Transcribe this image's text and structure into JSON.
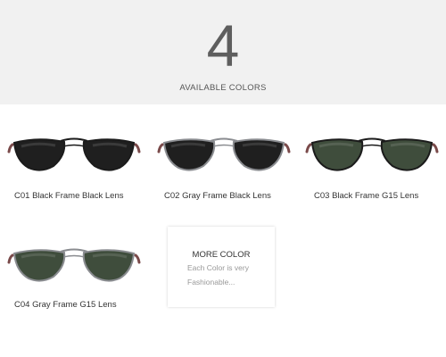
{
  "header": {
    "number": "4",
    "subtitle": "AVAILABLE COLORS"
  },
  "products": [
    {
      "code_label": "C01 Black Frame Black Lens",
      "frame_color": "#1b1b1b",
      "lens_color": "#1f1f1f",
      "temple_color": "#7a4a4a"
    },
    {
      "code_label": "C02 Gray Frame Black Lens",
      "frame_color": "#8a8c90",
      "lens_color": "#1f1f1f",
      "temple_color": "#7a4a4a"
    },
    {
      "code_label": "C03 Black Frame G15 Lens",
      "frame_color": "#1b1b1b",
      "lens_color": "#3f4d3c",
      "temple_color": "#7a4a4a"
    },
    {
      "code_label": "C04 Gray Frame G15 Lens",
      "frame_color": "#8a8c90",
      "lens_color": "#3f4d3c",
      "temple_color": "#7a4a4a"
    }
  ],
  "more_color": {
    "title": "MORE COLOR",
    "line1": "Each Color is very",
    "line2": "Fashionable..."
  }
}
